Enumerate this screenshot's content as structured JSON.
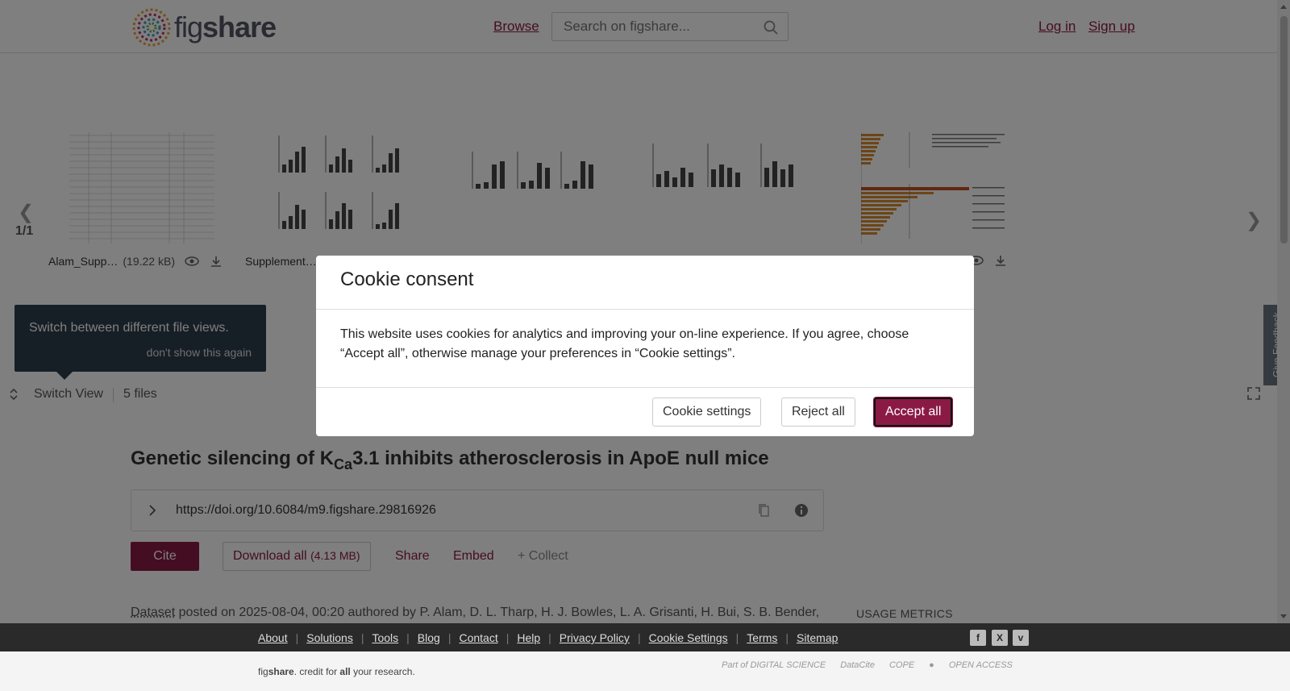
{
  "header": {
    "logo_text_light": "fig",
    "logo_text_bold": "share",
    "browse": "Browse",
    "search_placeholder": "Search on figshare...",
    "login": "Log in",
    "signup": "Sign up"
  },
  "viewer": {
    "page": "1/1",
    "files": [
      {
        "name": "Alam_Supp…",
        "size": "(19.22 kB)"
      },
      {
        "name": "Supplement…",
        "size": ""
      },
      {
        "name": "",
        "size": ""
      },
      {
        "name": "",
        "size": ""
      },
      {
        "name": "",
        "size": ""
      }
    ],
    "tip_text": "Switch between different file views.",
    "tip_dismiss": "don't show this again",
    "switch_view": "Switch View",
    "files_count": "5 files",
    "feedback": "Give Feedback"
  },
  "article": {
    "title_pre": "Genetic silencing of K",
    "title_sub": "Ca",
    "title_post": "3.1 inhibits atherosclerosis in ApoE null mice",
    "doi": "https://doi.org/10.6084/m9.figshare.29816926",
    "cite": "Cite",
    "download_all": "Download all",
    "download_size": "(4.13 MB)",
    "share": "Share",
    "embed": "Embed",
    "collect": "+ Collect",
    "posted_type": "Dataset",
    "posted_text": " posted on 2025-08-04, 00:20 authored by P. Alam, D. L. Tharp, H. J. Bowles, L. A. Grisanti, H. Bui, S. B. Bender,",
    "usage_metrics": "USAGE METRICS"
  },
  "footer": {
    "links": [
      "About",
      "Solutions",
      "Tools",
      "Blog",
      "Contact",
      "Help",
      "Privacy Policy",
      "Cookie Settings",
      "Terms",
      "Sitemap"
    ],
    "tagline_fig": "fig",
    "tagline_share": "share",
    "tagline_mid": ". credit for ",
    "tagline_all": "all",
    "tagline_end": " your research.",
    "partner_ds": "Part of DIGITAL SCIENCE",
    "partner_datacite": "DataCite",
    "partner_cope": "COPE",
    "partner_oa": "OPEN ACCESS"
  },
  "cookie_modal": {
    "title": "Cookie consent",
    "body": "This website uses cookies for analytics and improving your on-line experience. If you agree, choose “Accept all”, otherwise manage your preferences in “Cookie settings”.",
    "settings": "Cookie settings",
    "reject": "Reject all",
    "accept": "Accept all"
  },
  "colors": {
    "brand": "#8a1a44",
    "tip_bg": "#2f3e4c",
    "footer_bg": "#2a2a2a"
  }
}
